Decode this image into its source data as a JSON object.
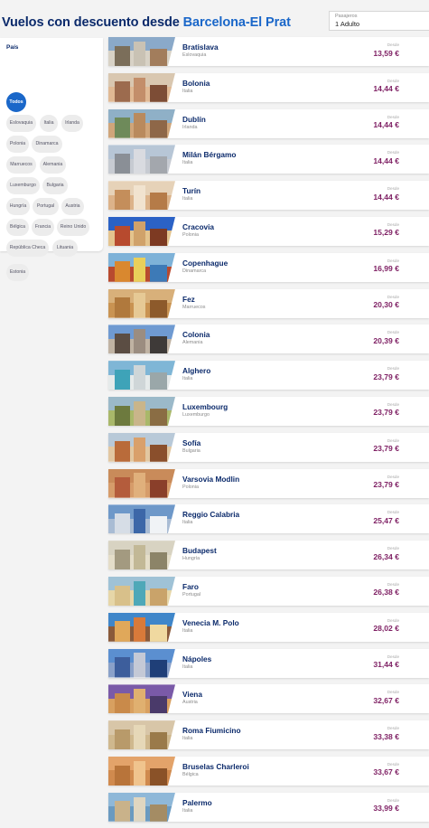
{
  "header": {
    "title_prefix": "Vuelos con descuento desde ",
    "title_highlight": "Barcelona-El Prat"
  },
  "passengers": {
    "label": "Pasajeros",
    "value": "1 Adulto"
  },
  "filter": {
    "title": "País",
    "chips": [
      "Todos",
      "Eslovaquia",
      "Italia",
      "Irlanda",
      "Polonia",
      "Dinamarca",
      "Marruecos",
      "Alemania",
      "Luxemburgo",
      "Bulgaria",
      "Hungría",
      "Portugal",
      "Austria",
      "Bélgica",
      "Francia",
      "Reino Unido",
      "República Checa",
      "Lituania",
      "Estonia"
    ],
    "selected": "Todos"
  },
  "desde_label": "Desde",
  "destinations": [
    {
      "city": "Bratislava",
      "country": "Eslovaquia",
      "price": "13,59 €"
    },
    {
      "city": "Bolonia",
      "country": "Italia",
      "price": "14,44 €"
    },
    {
      "city": "Dublín",
      "country": "Irlanda",
      "price": "14,44 €"
    },
    {
      "city": "Milán Bérgamo",
      "country": "Italia",
      "price": "14,44 €"
    },
    {
      "city": "Turín",
      "country": "Italia",
      "price": "14,44 €"
    },
    {
      "city": "Cracovia",
      "country": "Polonia",
      "price": "15,29 €"
    },
    {
      "city": "Copenhague",
      "country": "Dinamarca",
      "price": "16,99 €"
    },
    {
      "city": "Fez",
      "country": "Marruecos",
      "price": "20,30 €"
    },
    {
      "city": "Colonia",
      "country": "Alemania",
      "price": "20,39 €"
    },
    {
      "city": "Alghero",
      "country": "Italia",
      "price": "23,79 €"
    },
    {
      "city": "Luxembourg",
      "country": "Luxemburgo",
      "price": "23,79 €"
    },
    {
      "city": "Sofía",
      "country": "Bulgaria",
      "price": "23,79 €"
    },
    {
      "city": "Varsovia Modlin",
      "country": "Polonia",
      "price": "23,79 €"
    },
    {
      "city": "Reggio Calabria",
      "country": "Italia",
      "price": "25,47 €"
    },
    {
      "city": "Budapest",
      "country": "Hungría",
      "price": "26,34 €"
    },
    {
      "city": "Faro",
      "country": "Portugal",
      "price": "26,38 €"
    },
    {
      "city": "Venecia M. Polo",
      "country": "Italia",
      "price": "28,02 €"
    },
    {
      "city": "Nápoles",
      "country": "Italia",
      "price": "31,44 €"
    },
    {
      "city": "Viena",
      "country": "Austria",
      "price": "32,67 €"
    },
    {
      "city": "Roma Fiumicino",
      "country": "Italia",
      "price": "33,38 €"
    },
    {
      "city": "Bruselas Charleroi",
      "country": "Bélgica",
      "price": "33,67 €"
    },
    {
      "city": "Palermo",
      "country": "Italia",
      "price": "33,99 €"
    }
  ],
  "colors": {
    "navy": "#0b2a6b",
    "accent_blue": "#1a67c9",
    "price": "#7e1f63"
  }
}
